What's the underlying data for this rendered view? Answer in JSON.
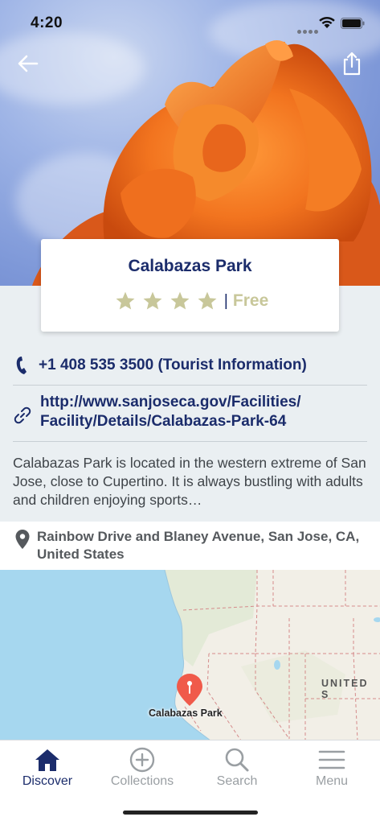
{
  "status_bar": {
    "time": "4:20"
  },
  "place": {
    "title": "Calabazas Park",
    "rating": 4,
    "rating_max": 4,
    "price": "Free",
    "phone": "+1 408 535 3500 (Tourist Information)",
    "url_line1": "http://www.sanjoseca.gov/Facilities/",
    "url_line2": "Facility/Details/Calabazas-Park-64",
    "description": "Calabazas Park is located in the western extreme of San Jose, close to Cupertino. It is always bustling with adults and children enjoying sports…",
    "address_line1": "Rainbow Drive and Blaney Avenue, San Jose, CA,",
    "address_line2": "United States"
  },
  "map": {
    "region_label": "UNITED S",
    "pin_label": "Calabazas Park"
  },
  "tabs": [
    {
      "label": "Discover",
      "icon": "home-icon",
      "active": true
    },
    {
      "label": "Collections",
      "icon": "plus-circle-icon",
      "active": false
    },
    {
      "label": "Search",
      "icon": "search-icon",
      "active": false
    },
    {
      "label": "Menu",
      "icon": "hamburger-icon",
      "active": false
    }
  ],
  "colors": {
    "accent": "#1b2c6b",
    "star": "#c8c79a",
    "pin": "#f05a4a",
    "water": "#a6d7ef"
  }
}
